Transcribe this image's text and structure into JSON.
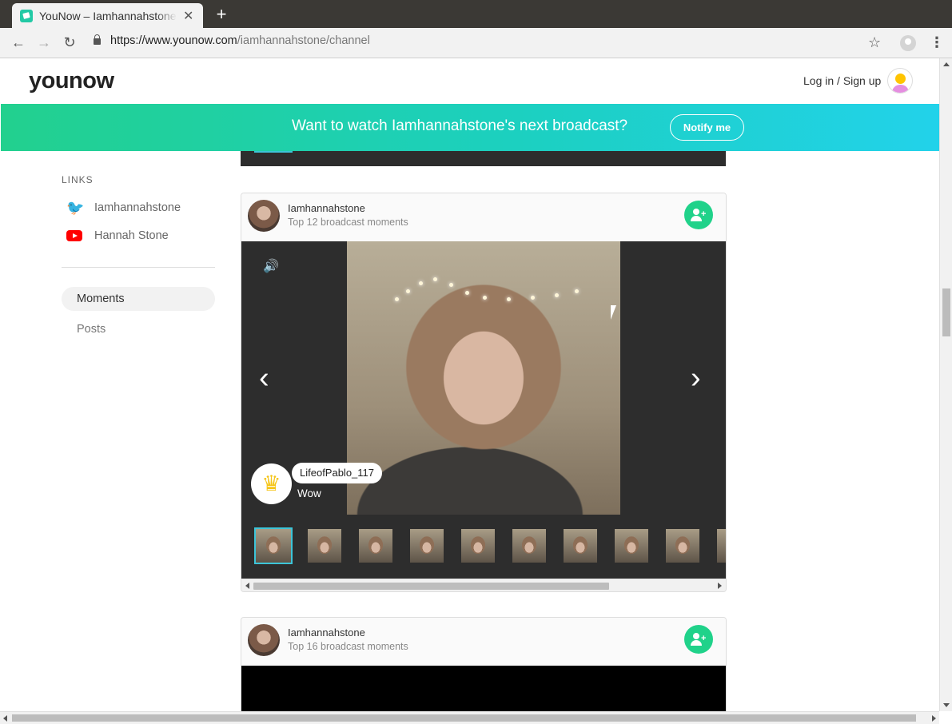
{
  "browser": {
    "tab_title": "YouNow – Iamhannahstone",
    "tab_close": "✕",
    "new_tab": "+",
    "url_host": "https://www.younow.com",
    "url_path": "/iamhannahstone/channel"
  },
  "header": {
    "logo": "younow",
    "login_label": "Log in / Sign up"
  },
  "banner": {
    "text": "Want to watch Iamhannahstone's next broadcast?",
    "button_label": "Notify me"
  },
  "sidebar": {
    "links_title": "LINKS",
    "links": [
      {
        "label": "Iamhannahstone",
        "icon": "twitter-icon"
      },
      {
        "label": "Hannah Stone",
        "icon": "youtube-icon"
      }
    ],
    "menu": [
      {
        "label": "Moments",
        "active": true
      },
      {
        "label": "Posts",
        "active": false
      }
    ]
  },
  "cards": [
    {
      "username": "Iamhannahstone",
      "subtitle": "Top 12 broadcast moments",
      "comment_user": "LifeofPablo_117",
      "comment_text": "Wow"
    },
    {
      "username": "Iamhannahstone",
      "subtitle": "Top 16 broadcast moments"
    }
  ],
  "colors": {
    "accent_green": "#20d28a",
    "banner_start": "#22d08e",
    "banner_end": "#22d2ea",
    "selected_thumb": "#3cc4d8"
  }
}
